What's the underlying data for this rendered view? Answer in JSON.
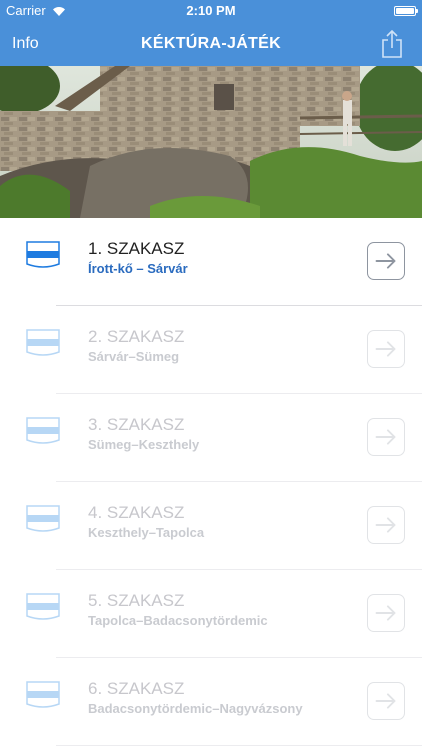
{
  "status": {
    "carrier": "Carrier",
    "time": "2:10 PM"
  },
  "nav": {
    "left_button": "Info",
    "title": "KÉKTÚRA-JÁTÉK",
    "right_icon": "share-icon"
  },
  "hero": {
    "image": "stone castle ruin wall with rocks, vegetation and a hiker"
  },
  "sections": [
    {
      "name": "1. SZAKASZ",
      "route": "Írott-kő – Sárvár",
      "enabled": true
    },
    {
      "name": "2. SZAKASZ",
      "route": "Sárvár–Sümeg",
      "enabled": false
    },
    {
      "name": "3. SZAKASZ",
      "route": "Sümeg–Keszthely",
      "enabled": false
    },
    {
      "name": "4. SZAKASZ",
      "route": "Keszthely–Tapolca",
      "enabled": false
    },
    {
      "name": "5. SZAKASZ",
      "route": "Tapolca–Badacsonytördemic",
      "enabled": false
    },
    {
      "name": "6. SZAKASZ",
      "route": "Badacsonytördemic–Nagyvázsony",
      "enabled": false
    }
  ],
  "colors": {
    "nav_bar": "#4a90d9",
    "route_active": "#2a6bbf",
    "flag_stripe_active": "#1e7be0",
    "flag_stripe_inactive": "#b7d7f5",
    "text_inactive": "#c7c7cc"
  },
  "icons": {
    "flag": "blue-trail-flag-icon",
    "arrow": "arrow-right-icon"
  }
}
